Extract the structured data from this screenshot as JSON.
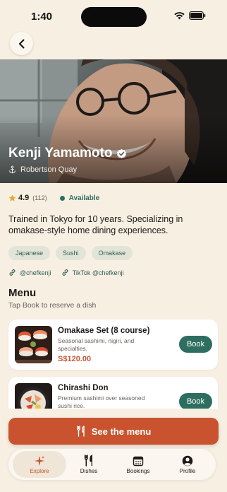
{
  "status_bar": {
    "time": "1:40"
  },
  "chef": {
    "name": "Kenji Yamamoto",
    "location": "Robertson Quay",
    "rating": "4.9",
    "review_count": "(112)",
    "availability": "Available",
    "bio": "Trained in Tokyo for 10 years. Specializing in omakase-style home dining experiences.",
    "tags": [
      "Japanese",
      "Sushi",
      "Omakase"
    ],
    "socials": [
      "@chefkenji",
      "TikTok @chefkenji"
    ]
  },
  "menu": {
    "title": "Menu",
    "subtitle": "Tap Book to reserve a dish",
    "dishes": [
      {
        "name": "Omakase Set (8 course)",
        "description": "Seasonal sashimi, nigiri, and specialties.",
        "price": "S$120.00",
        "book_label": "Book"
      },
      {
        "name": "Chirashi Don",
        "description": "Premium sashimi over seasoned sushi rice.",
        "price": "",
        "book_label": "Book"
      }
    ]
  },
  "cta": {
    "label": "See the menu"
  },
  "tabbar": {
    "tabs": [
      {
        "label": "Explore",
        "icon": "sparkle-icon",
        "active": true
      },
      {
        "label": "Dishes",
        "icon": "fork-knife-icon",
        "active": false
      },
      {
        "label": "Bookings",
        "icon": "calendar-icon",
        "active": false
      },
      {
        "label": "Profile",
        "icon": "person-icon",
        "active": false
      }
    ]
  },
  "colors": {
    "accent": "#c8532e",
    "green": "#2e6e60",
    "background": "#f8efe3"
  }
}
